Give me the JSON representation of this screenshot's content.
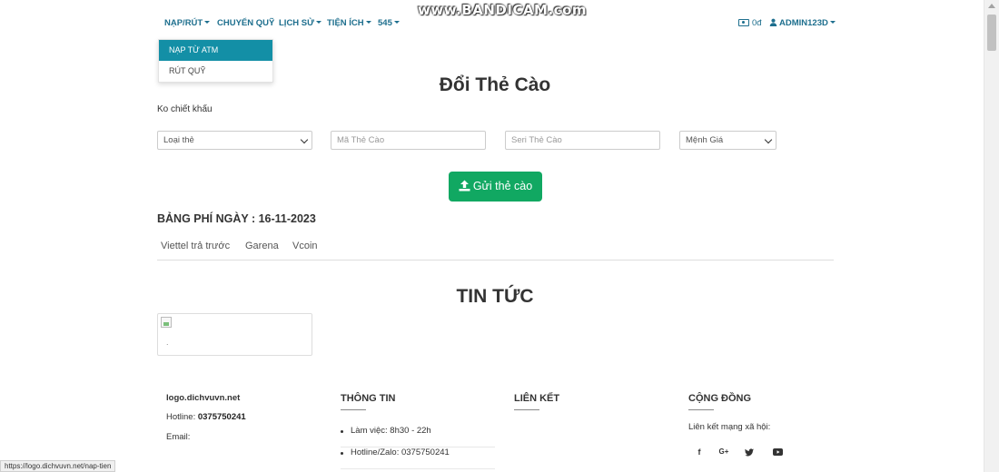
{
  "watermark": "www.BANDICAM.com",
  "nav": {
    "items": [
      {
        "label": "NẠP/RÚT",
        "caret": true
      },
      {
        "label": "CHUYỂN QUỸ",
        "caret": false
      },
      {
        "label": "LỊCH SỬ",
        "caret": true
      },
      {
        "label": "TIỆN ÍCH",
        "caret": true
      },
      {
        "label": "545",
        "caret": true
      }
    ],
    "balance": "0đ",
    "user": "ADMIN123D"
  },
  "dropdown": {
    "items": [
      {
        "label": "NẠP TỪ ATM",
        "active": true
      },
      {
        "label": "RÚT QUỸ",
        "active": false
      }
    ]
  },
  "page": {
    "title": "Đổi Thẻ Cào",
    "note": "Ko chiết khấu"
  },
  "form": {
    "card_type": "Loại thẻ",
    "code_placeholder": "Mã Thẻ Cào",
    "serial_placeholder": "Seri Thẻ Cào",
    "denomination": "Mệnh Giá",
    "submit_label": "Gửi thẻ cào"
  },
  "fees": {
    "title": "BẢNG PHÍ NGÀY : 16-11-2023",
    "tabs": [
      "Viettel trả trước",
      "Garena",
      "Vcoin"
    ]
  },
  "news": {
    "title": "TIN TỨC",
    "card_caption": "."
  },
  "footer": {
    "site": "logo.dichvuvn.net",
    "hotline_label": "Hotline:",
    "hotline_value": "0375750241",
    "email_label": "Email:",
    "info_title": "THÔNG TIN",
    "info_items": [
      "Làm việc: 8h30 - 22h",
      "Hotline/Zalo: 0375750241"
    ],
    "links_title": "LIÊN KẾT",
    "community_title": "CỘNG ĐỒNG",
    "community_text": "Liên kết mạng xã hội:",
    "social": [
      "f",
      "G+",
      "twitter-icon",
      "youtube-icon"
    ]
  },
  "status_url": "https://logo.dichvuvn.net/nap-tien",
  "colors": {
    "nav_text": "#1e6f8e",
    "dropdown_active": "#138fa6",
    "submit_button": "#11a862"
  }
}
